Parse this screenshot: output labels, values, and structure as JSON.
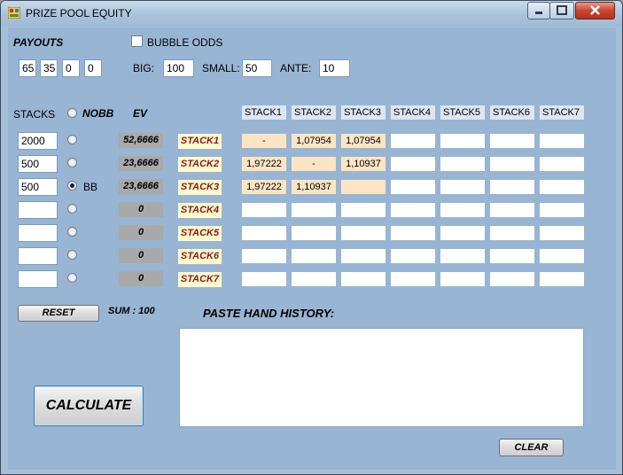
{
  "window": {
    "title": "PRIZE POOL EQUITY"
  },
  "payouts": {
    "label": "PAYOUTS",
    "values": [
      "65",
      "35",
      "0",
      "0"
    ]
  },
  "bubble_odds": {
    "label": "BUBBLE ODDS",
    "checked": false
  },
  "blinds": {
    "big_label": "BIG:",
    "big": "100",
    "small_label": "SMALL:",
    "small": "50",
    "ante_label": "ANTE:",
    "ante": "10"
  },
  "headers": {
    "stacks": "STACKS",
    "nobb": "NOBB",
    "ev": "EV",
    "bb": "BB"
  },
  "stack_columns": [
    "STACK1",
    "STACK2",
    "STACK3",
    "STACK4",
    "STACK5",
    "STACK6",
    "STACK7"
  ],
  "rows": [
    {
      "stack": "2000",
      "ev": "52,6666",
      "label": "STACK1",
      "bb": false,
      "cells": [
        "-",
        "1,07954",
        "1,07954",
        "",
        "",
        "",
        ""
      ]
    },
    {
      "stack": "500",
      "ev": "23,6666",
      "label": "STACK2",
      "bb": false,
      "cells": [
        "1,97222",
        "-",
        "1,10937",
        "",
        "",
        "",
        ""
      ]
    },
    {
      "stack": "500",
      "ev": "23,6666",
      "label": "STACK3",
      "bb": true,
      "cells": [
        "1,97222",
        "1,10937",
        "",
        "",
        "",
        "",
        ""
      ]
    },
    {
      "stack": "",
      "ev": "0",
      "label": "STACK4",
      "bb": false,
      "cells": [
        "",
        "",
        "",
        "",
        "",
        "",
        ""
      ]
    },
    {
      "stack": "",
      "ev": "0",
      "label": "STACK5",
      "bb": false,
      "cells": [
        "",
        "",
        "",
        "",
        "",
        "",
        ""
      ]
    },
    {
      "stack": "",
      "ev": "0",
      "label": "STACK6",
      "bb": false,
      "cells": [
        "",
        "",
        "",
        "",
        "",
        "",
        ""
      ]
    },
    {
      "stack": "",
      "ev": "0",
      "label": "STACK7",
      "bb": false,
      "cells": [
        "",
        "",
        "",
        "",
        "",
        "",
        ""
      ]
    }
  ],
  "highlighted_cells": [
    [
      0,
      0
    ],
    [
      0,
      1
    ],
    [
      0,
      2
    ],
    [
      1,
      0
    ],
    [
      1,
      1
    ],
    [
      1,
      2
    ],
    [
      2,
      0
    ],
    [
      2,
      1
    ],
    [
      2,
      2
    ]
  ],
  "buttons": {
    "reset": "RESET",
    "calculate": "CALCULATE",
    "clear": "CLEAR"
  },
  "sum": {
    "text": "SUM : 100"
  },
  "hand_history": {
    "label": "PASTE HAND HISTORY:",
    "value": ""
  },
  "colors": {
    "client_bg": "#98b5d3",
    "ev_box": "#a9a9a9",
    "stack_label_bg": "#fffacd",
    "stack_label_text": "#8b1a1a",
    "filled_cell": "#fde5c4",
    "column_header_bg": "#dde6f3"
  }
}
